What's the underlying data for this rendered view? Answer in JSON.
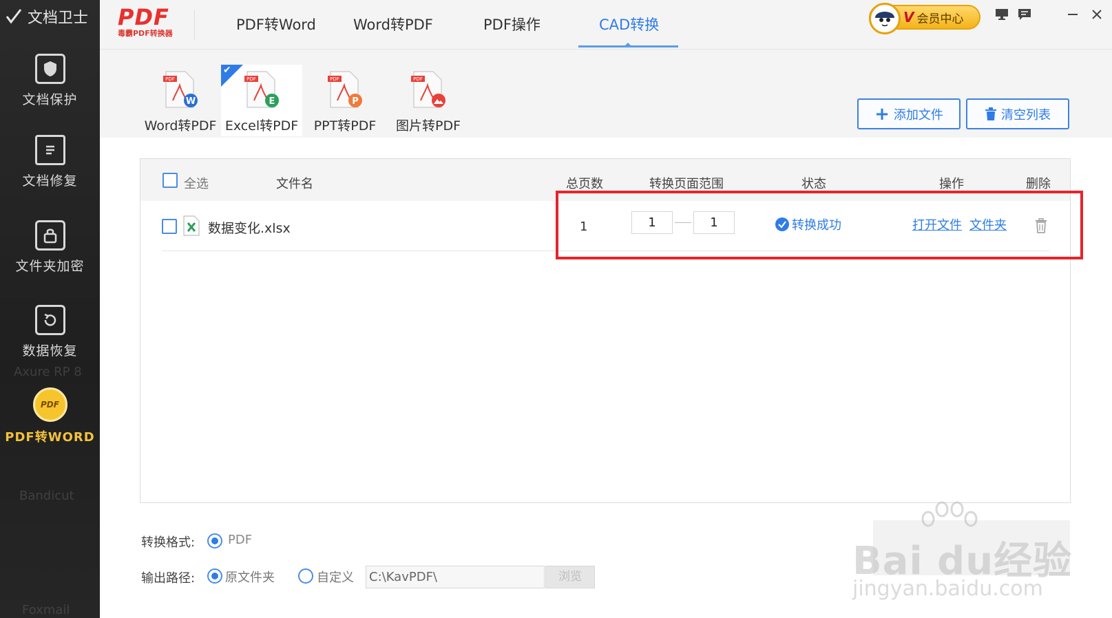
{
  "sidebar": {
    "title": "文档卫士",
    "items": [
      {
        "label": "文档保护",
        "icon": "shield-icon"
      },
      {
        "label": "文档修复",
        "icon": "document-repair-icon"
      },
      {
        "label": "文件夹加密",
        "icon": "lock-icon"
      },
      {
        "label": "数据恢复",
        "icon": "restore-icon"
      },
      {
        "label": "PDF转WORD",
        "icon": "pdf-icon",
        "badge": "PDF"
      }
    ],
    "ghost_labels": [
      "Axure RP 8",
      "Bandicut",
      "Foxmail"
    ]
  },
  "header": {
    "brand_logo": "PDF",
    "brand_sub": "毒霸PDF转换器",
    "tabs": [
      {
        "label": "PDF转Word"
      },
      {
        "label": "Word转PDF"
      },
      {
        "label": "PDF操作"
      },
      {
        "label": "CAD转换"
      }
    ],
    "active_tab": "CAD转换",
    "vip": {
      "letter": "V",
      "label": "会员中心"
    }
  },
  "subtabs": [
    {
      "label": "Word转PDF",
      "badge": "W",
      "color": "#2b6fd6"
    },
    {
      "label": "Excel转PDF",
      "badge": "E",
      "color": "#2aa05a"
    },
    {
      "label": "PPT转PDF",
      "badge": "P",
      "color": "#f07a3a"
    },
    {
      "label": "图片转PDF",
      "badge": "",
      "color": "#e8413a"
    }
  ],
  "doc_tag": "PDF",
  "toolbar": {
    "add_label": "添加文件",
    "clear_label": "清空列表"
  },
  "table": {
    "headers": {
      "select_all": "全选",
      "filename": "文件名",
      "pages": "总页数",
      "range": "转换页面范围",
      "status": "状态",
      "actions": "操作",
      "delete": "删除"
    },
    "rows": [
      {
        "filename": "数据变化.xlsx",
        "pages": "1",
        "range_from": "1",
        "range_to": "1",
        "status": "转换成功",
        "open_file": "打开文件",
        "open_folder": "文件夹"
      }
    ]
  },
  "options": {
    "format_label": "转换格式:",
    "format_value": "PDF",
    "output_label": "输出路径:",
    "output_original": "原文件夹",
    "output_custom": "自定义",
    "output_path": "C:\\KavPDF\\",
    "browse_label": "浏览"
  },
  "watermark": {
    "main": "Bai du经验",
    "sub": "jingyan.baidu.com"
  },
  "colors": {
    "accent": "#2f7ce6",
    "highlight": "#e5252c",
    "brand": "#e8312f",
    "vip": "#f4b419",
    "sidebar_active": "#f3c23d"
  }
}
